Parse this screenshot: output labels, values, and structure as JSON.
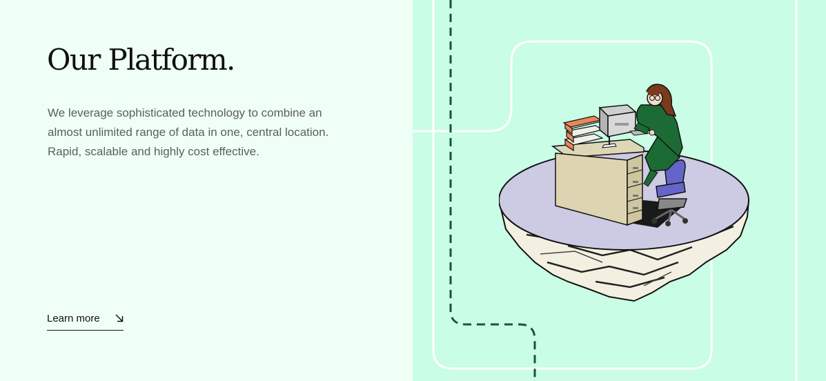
{
  "section": {
    "title": "Our Platform.",
    "description": "We leverage sophisticated technology to combine an almost unlimited range of data in one, central location. Rapid, scalable and highly cost effective.",
    "cta_label": "Learn more"
  },
  "icons": {
    "cta_arrow": "arrow-down-right-icon"
  },
  "colors": {
    "left_background": "#effff6",
    "right_background": "#c9fde6",
    "dashed_path": "#14573a",
    "frame_lines": "#ffffff"
  }
}
